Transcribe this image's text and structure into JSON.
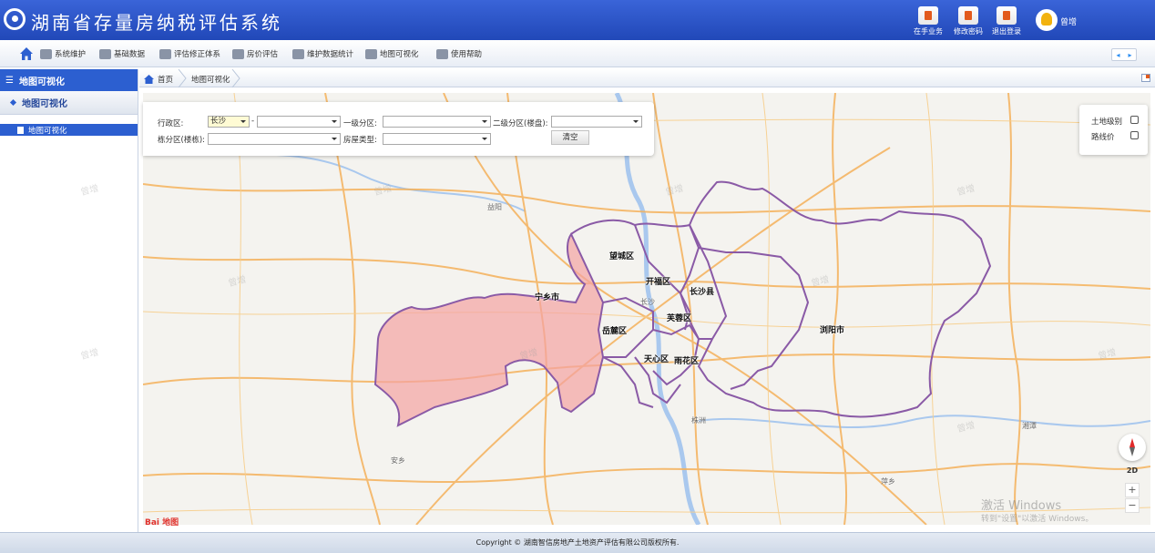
{
  "header": {
    "title": "湖南省存量房纳税评估系统",
    "buttons": [
      {
        "label": "在手业务",
        "icon": "briefcase-icon"
      },
      {
        "label": "修改密码",
        "icon": "lock-icon"
      },
      {
        "label": "退出登录",
        "icon": "logout-icon"
      }
    ],
    "user_name": "曾增"
  },
  "nav": {
    "items": [
      {
        "label": "系统维护",
        "icon": "users-icon"
      },
      {
        "label": "基础数据",
        "icon": "gear-icon"
      },
      {
        "label": "评估修正体系",
        "icon": "people-icon"
      },
      {
        "label": "房价评估",
        "icon": "person-icon"
      },
      {
        "label": "维护数据统计",
        "icon": "building-icon"
      },
      {
        "label": "地图可视化",
        "icon": "edit-icon"
      },
      {
        "label": "使用帮助",
        "icon": "help-icon"
      }
    ]
  },
  "sidebar": {
    "header": "地图可视化",
    "section": "地图可视化",
    "items": [
      {
        "label": "地图可视化"
      }
    ]
  },
  "tabs": [
    {
      "label": "首页"
    },
    {
      "label": "地图可视化"
    }
  ],
  "filter": {
    "admin_area_label": "行政区:",
    "admin_area_value": "长沙",
    "admin_area_sep": "-",
    "level1_label": "一级分区:",
    "level2_label": "二级分区(楼盘):",
    "building_label": "栋分区(楼栋):",
    "house_type_label": "房屋类型:",
    "clear_button": "清空"
  },
  "layers": [
    {
      "label": "土地级别",
      "checked": false
    },
    {
      "label": "路线价",
      "checked": false
    }
  ],
  "map": {
    "districts": [
      "望城区",
      "开福区",
      "长沙县",
      "宁乡市",
      "岳麓区",
      "芙蓉区",
      "天心区",
      "雨花区",
      "浏阳市"
    ],
    "cities": [
      "益阳",
      "长沙",
      "株洲",
      "湘潭",
      "安乡",
      "萍乡"
    ],
    "highlight_color": "#f4a3a3",
    "boundary_color": "#8a5aa6",
    "road_color": "#f4b15a",
    "baidu_logo": "Bai 地图",
    "control_2d": "2D",
    "zoom_in": "+",
    "zoom_out": "−",
    "activate_line1": "激活 Windows",
    "activate_line2": "转到\"设置\"以激活 Windows。"
  },
  "watermark": "曾增",
  "footer": "Copyright © 湖南智信房地产土地资产评估有限公司版权所有."
}
